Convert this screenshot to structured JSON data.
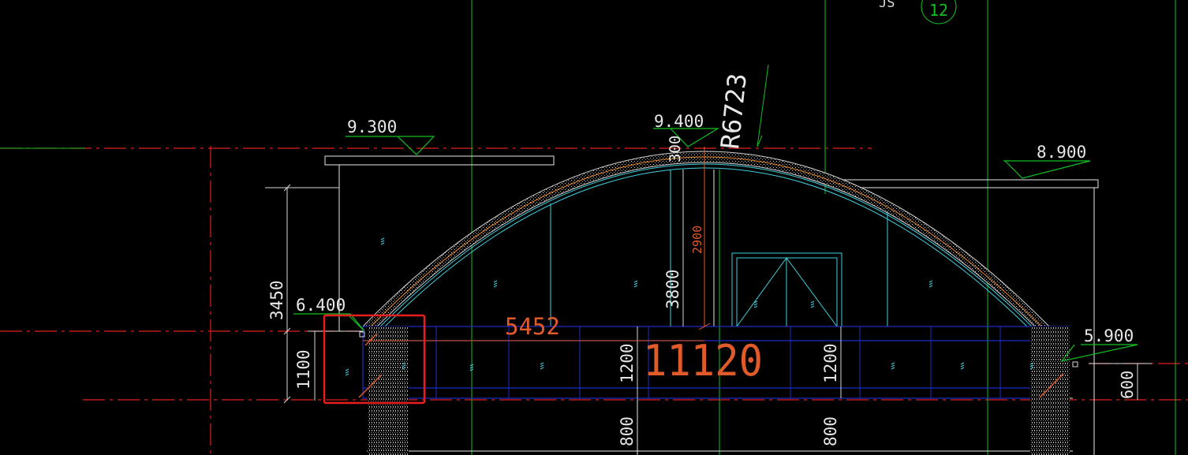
{
  "drawing": {
    "background": "#000000",
    "colors": {
      "axis_red": "#e0201c",
      "grid_green": "#10c020",
      "white": "#e8e8e8",
      "cyan": "#40d0e0",
      "blue": "#1e2ec8",
      "orange": "#e05a2a",
      "dim_white": "#d8d8d8",
      "highlight_box": "#e81e1e"
    },
    "grid_bubble": {
      "number": "12",
      "note": "JS"
    },
    "elevations": {
      "left_roof": "9.300",
      "crown": "9.400",
      "right_roof": "8.900",
      "left_eave": "6.400",
      "right_eave": "5.900"
    },
    "radius_label": "R6723",
    "dimensions": {
      "left_total": "3450",
      "left_parapet": "1100",
      "crown_thickness": "300",
      "rise_orange": "2900",
      "rise_white": "3800",
      "chord_orange": "5452",
      "span_orange": "11120",
      "beam_left": "1200",
      "beam_right": "1200",
      "lower_left": "800",
      "lower_right": "800",
      "right_parapet": "600"
    }
  }
}
